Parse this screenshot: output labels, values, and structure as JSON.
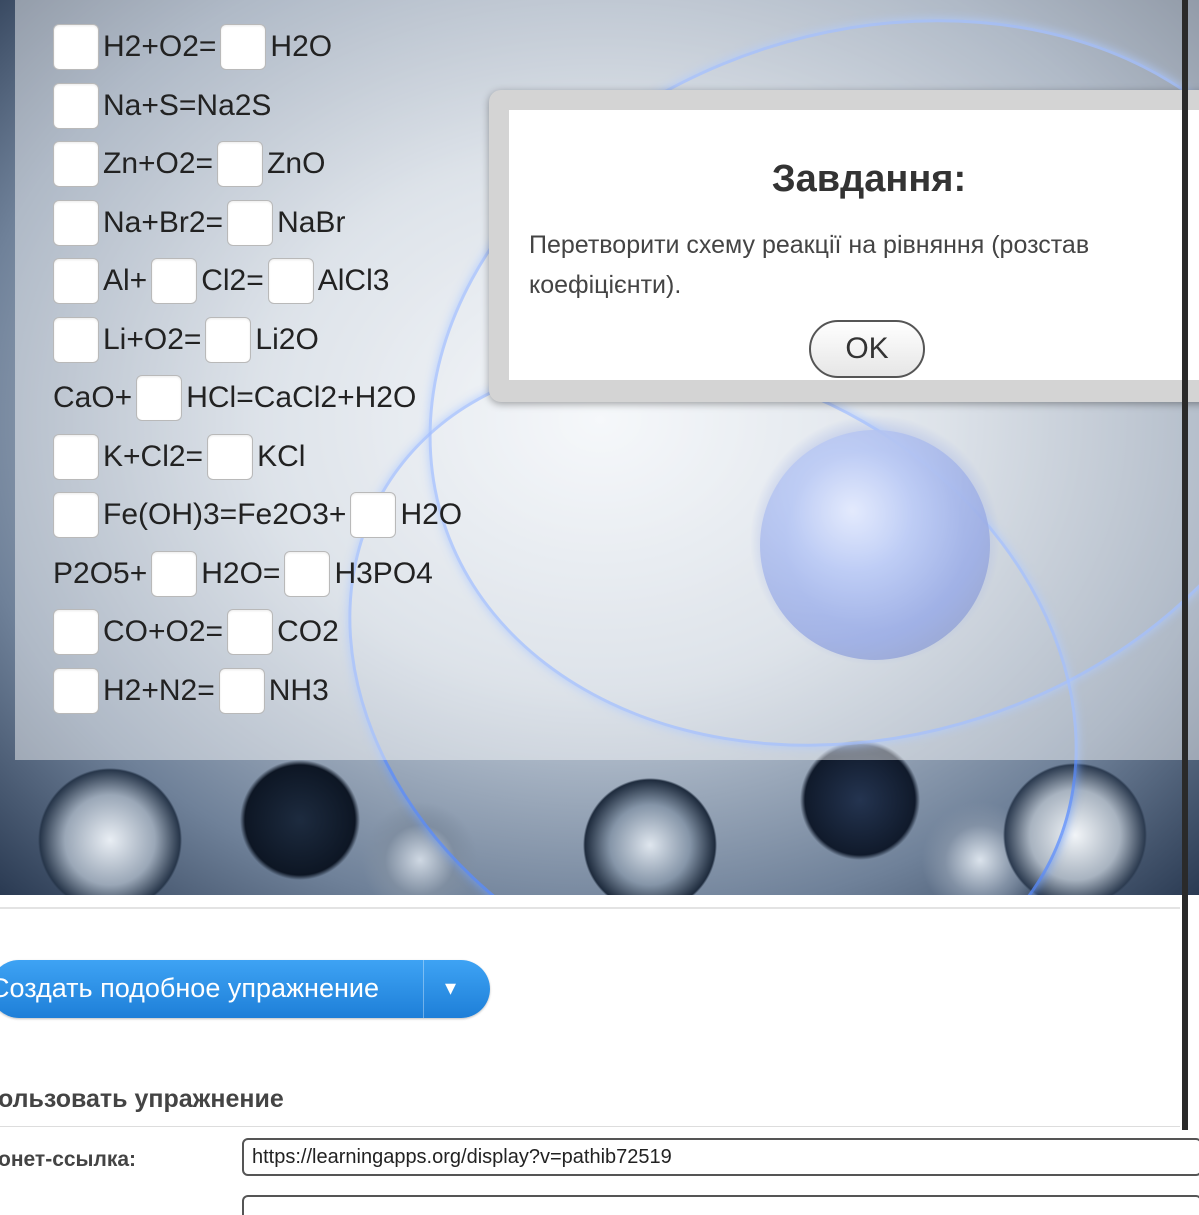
{
  "exercise": {
    "rows": [
      {
        "parts": [
          {
            "box": true
          },
          {
            "text": "H2+O2="
          },
          {
            "box": true
          },
          {
            "text": "H2O"
          }
        ]
      },
      {
        "parts": [
          {
            "box": true
          },
          {
            "text": "Na+S=Na2S"
          }
        ]
      },
      {
        "parts": [
          {
            "box": true
          },
          {
            "text": "Zn+O2="
          },
          {
            "box": true
          },
          {
            "text": "ZnO"
          }
        ]
      },
      {
        "parts": [
          {
            "box": true
          },
          {
            "text": "Na+Br2="
          },
          {
            "box": true
          },
          {
            "text": "NaBr"
          }
        ]
      },
      {
        "parts": [
          {
            "box": true
          },
          {
            "text": "Al+"
          },
          {
            "box": true
          },
          {
            "text": "Cl2="
          },
          {
            "box": true
          },
          {
            "text": "AlCl3"
          }
        ]
      },
      {
        "parts": [
          {
            "box": true
          },
          {
            "text": "Li+O2="
          },
          {
            "box": true
          },
          {
            "text": "Li2O"
          }
        ]
      },
      {
        "parts": [
          {
            "text": "CaO+"
          },
          {
            "box": true
          },
          {
            "text": "HCl=CaCl2+H2O"
          }
        ]
      },
      {
        "parts": [
          {
            "box": true
          },
          {
            "text": "K+Cl2="
          },
          {
            "box": true
          },
          {
            "text": "KCl"
          }
        ]
      },
      {
        "parts": [
          {
            "box": true
          },
          {
            "text": "Fe(OH)3=Fe2O3+"
          },
          {
            "box": true
          },
          {
            "text": "H2O"
          }
        ]
      },
      {
        "parts": [
          {
            "text": "P2O5+"
          },
          {
            "box": true
          },
          {
            "text": "H2O="
          },
          {
            "box": true
          },
          {
            "text": "H3PO4"
          }
        ]
      },
      {
        "parts": [
          {
            "box": true
          },
          {
            "text": "CO+O2="
          },
          {
            "box": true
          },
          {
            "text": "CO2"
          }
        ]
      },
      {
        "parts": [
          {
            "box": true
          },
          {
            "text": "H2+N2="
          },
          {
            "box": true
          },
          {
            "text": "NH3"
          }
        ]
      }
    ]
  },
  "dialog": {
    "title": "Завдання:",
    "body": "Перетворити схему реакції на рівняння (розстав коефіцієнти).",
    "ok_label": "OK"
  },
  "footer": {
    "create_button_label": "Создать подобное упражнение",
    "create_dropdown_icon": "caret-down-icon",
    "use_heading": "ользовать упражнение",
    "link_label": "онет-ссылка:",
    "link_value": "https://learningapps.org/display?v=pathib72519"
  }
}
